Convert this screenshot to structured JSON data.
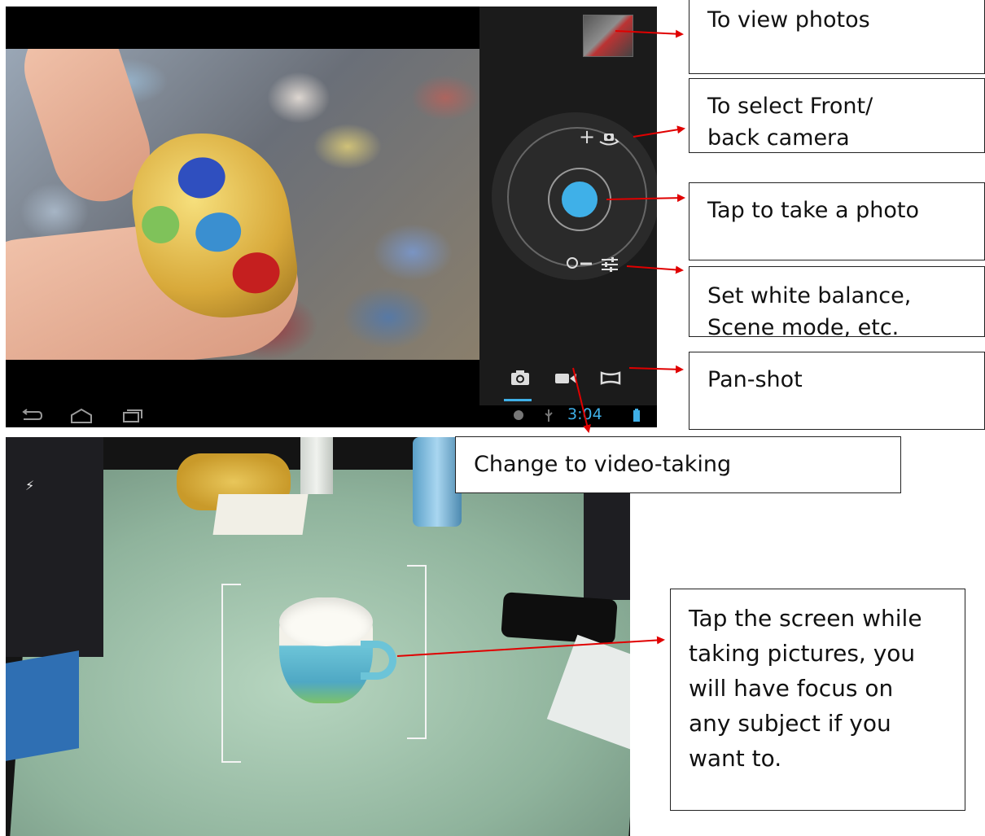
{
  "camera_screen": {
    "status_bar": {
      "time": "3:04"
    },
    "nav_icons": [
      "back-icon",
      "home-icon",
      "recent-apps-icon"
    ],
    "status_icons": [
      "android-debug-icon",
      "usb-icon",
      "battery-icon"
    ],
    "controls": {
      "zoom_in_glyph": "+",
      "modes": [
        "camera-mode-icon",
        "video-mode-icon",
        "panorama-mode-icon"
      ]
    }
  },
  "focus_screen": {
    "flash_glyph": "⚡"
  },
  "annotations": {
    "view_photos": "To view photos",
    "select_camera_line1": "To select Front/",
    "select_camera_line2": "back camera",
    "take_photo": "Tap to take a photo",
    "settings_line1": "Set white balance,",
    "settings_line2": "Scene mode, etc.",
    "pan_shot": "Pan-shot",
    "video_taking": "Change to video-taking",
    "focus_line1": "Tap the screen while",
    "focus_line2": "taking pictures, you",
    "focus_line3": "will have focus on",
    "focus_line4": "any subject if you",
    "focus_line5": "want to."
  },
  "colors": {
    "accent": "#3fb0e8",
    "arrow": "#e00000"
  }
}
